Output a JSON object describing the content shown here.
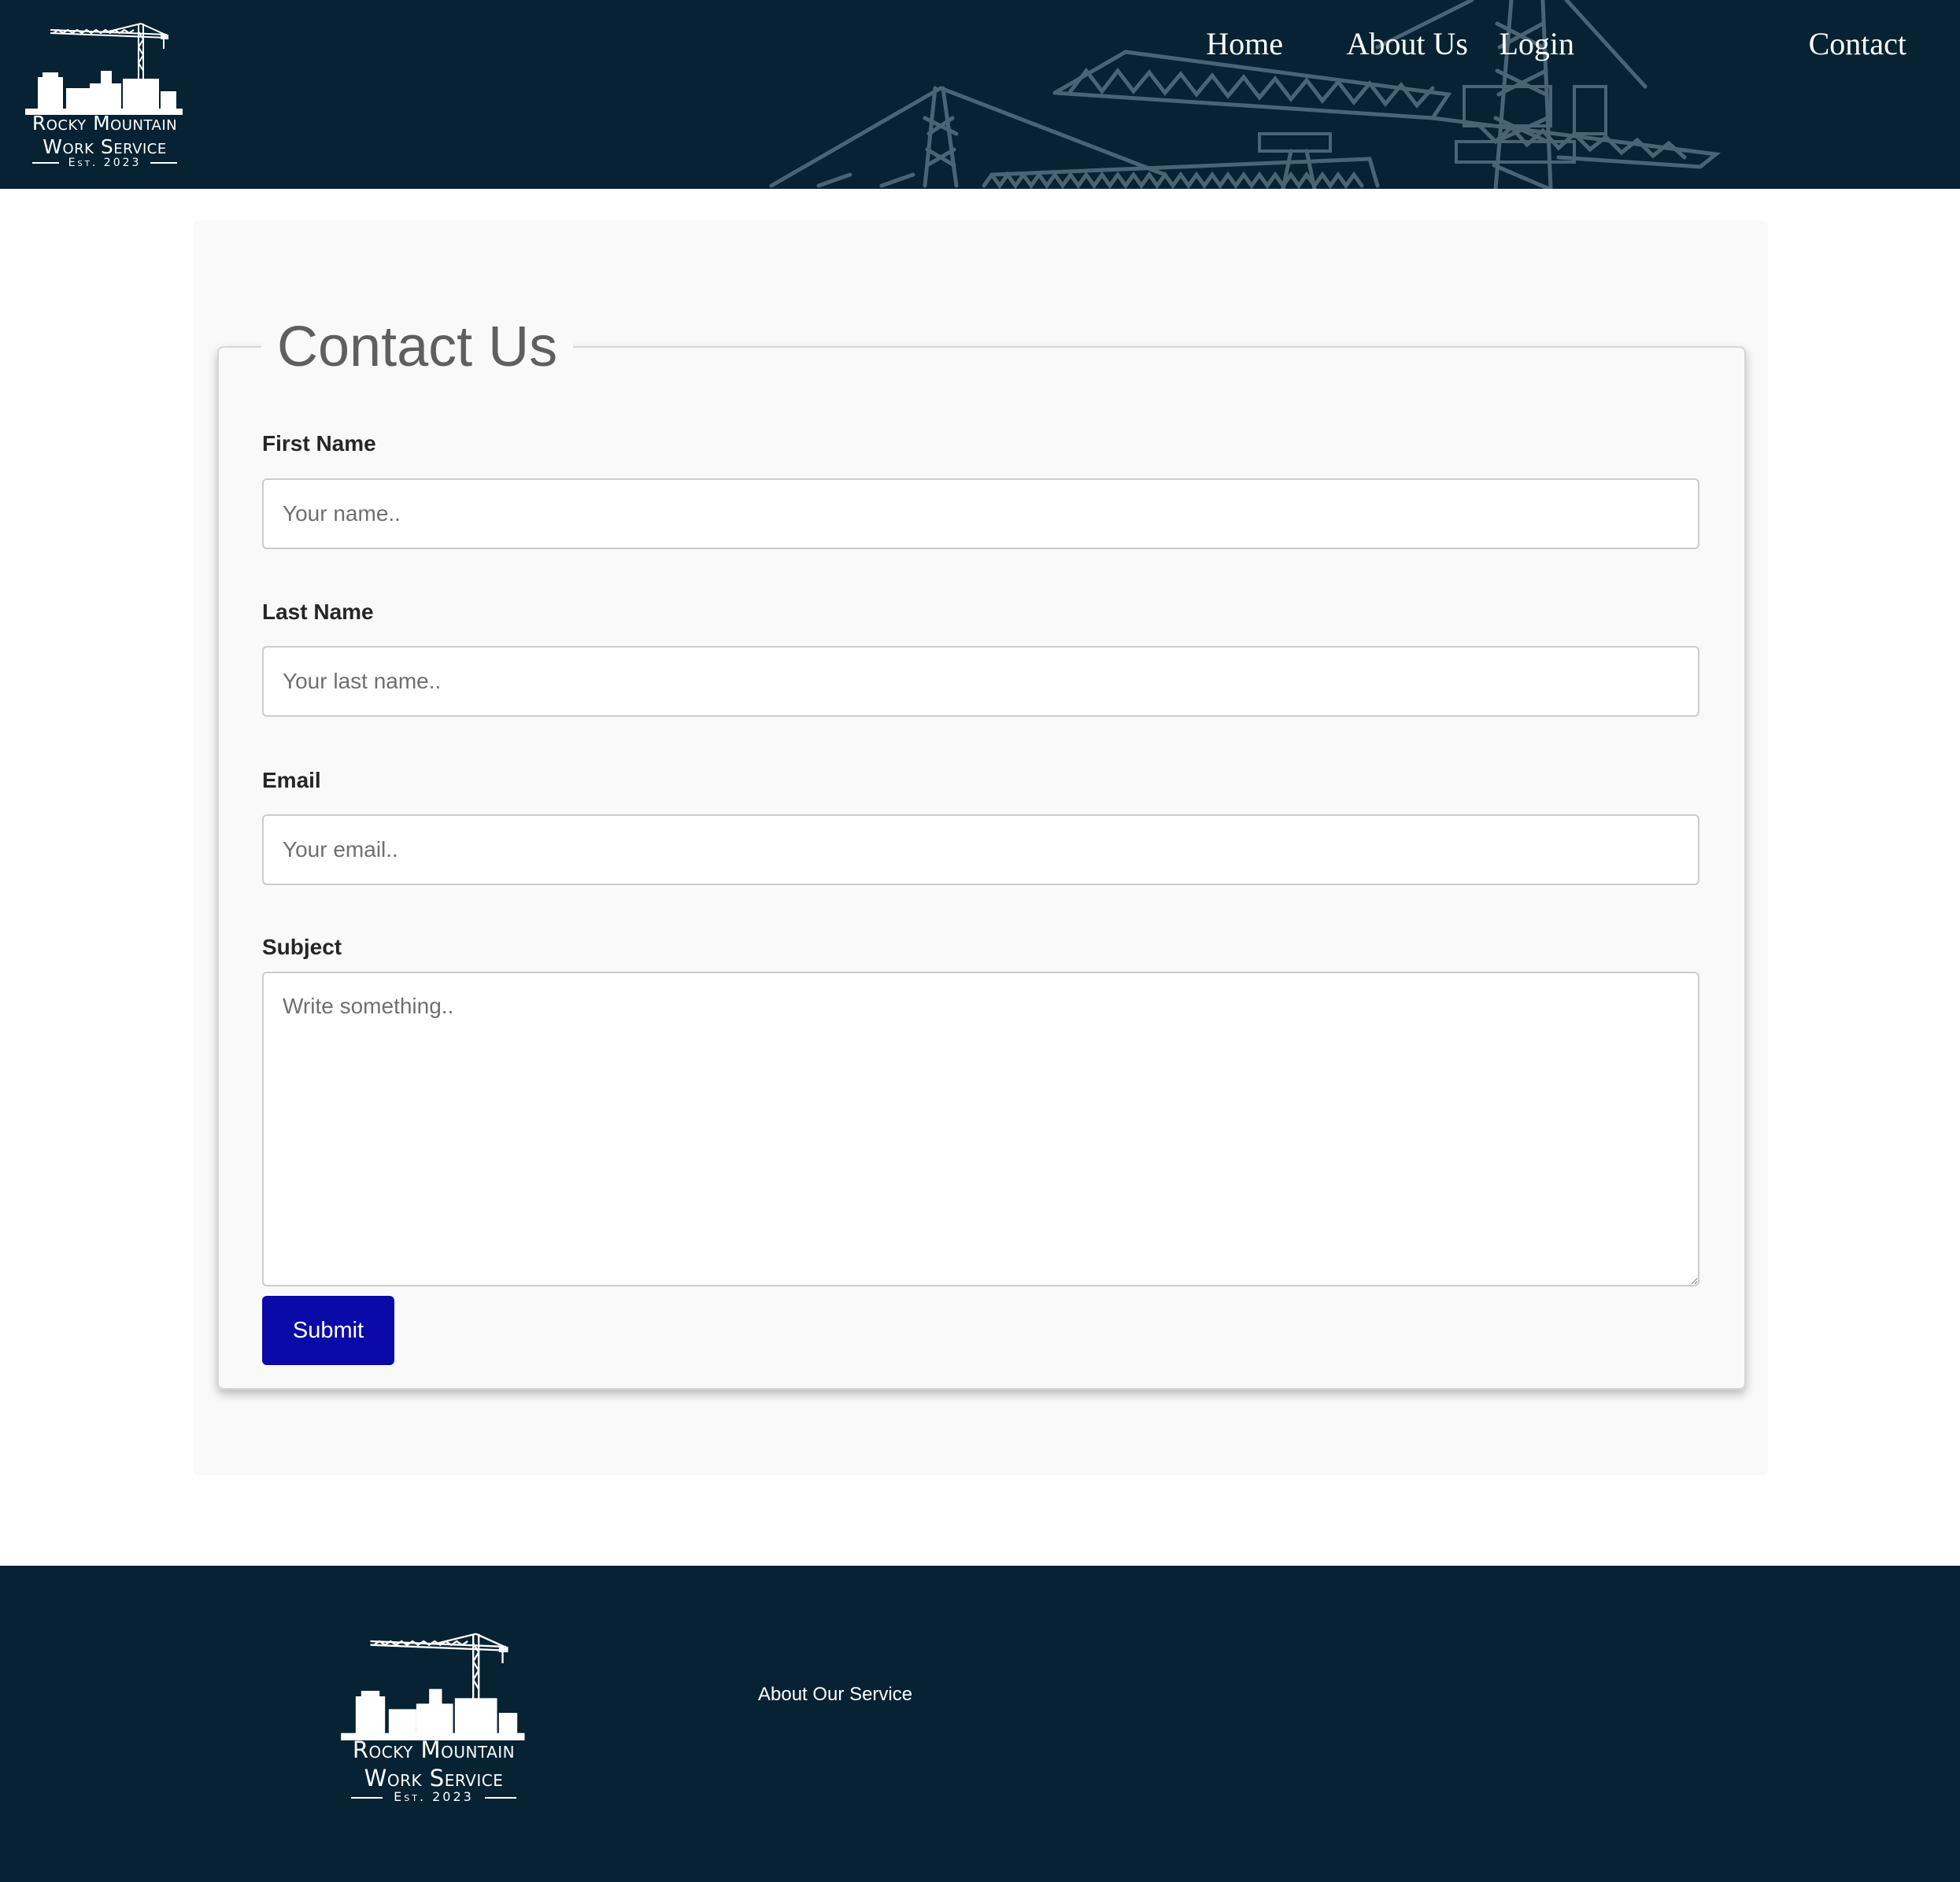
{
  "brand": {
    "line1": "Rocky Mountain",
    "line2": "Work Service",
    "est": "Est. 2023"
  },
  "nav": {
    "items": [
      {
        "label": "Home"
      },
      {
        "label": "About Us"
      },
      {
        "label": "Login"
      },
      {
        "label": "Contact"
      }
    ]
  },
  "form": {
    "legend": "Contact Us",
    "first_name": {
      "label": "First Name",
      "placeholder": "Your name.."
    },
    "last_name": {
      "label": "Last Name",
      "placeholder": "Your last name.."
    },
    "email": {
      "label": "Email",
      "placeholder": "Your email.."
    },
    "subject": {
      "label": "Subject",
      "placeholder": "Write something.."
    },
    "submit_label": "Submit"
  },
  "footer": {
    "link": "About Our Service"
  },
  "colors": {
    "header_bg": "#062233",
    "button_bg": "#0a0aa8",
    "panel_bg": "#f9f9f9"
  },
  "icons": {
    "logo": "crane-skyline-logo-icon",
    "header_art": "construction-cranes-icon"
  }
}
